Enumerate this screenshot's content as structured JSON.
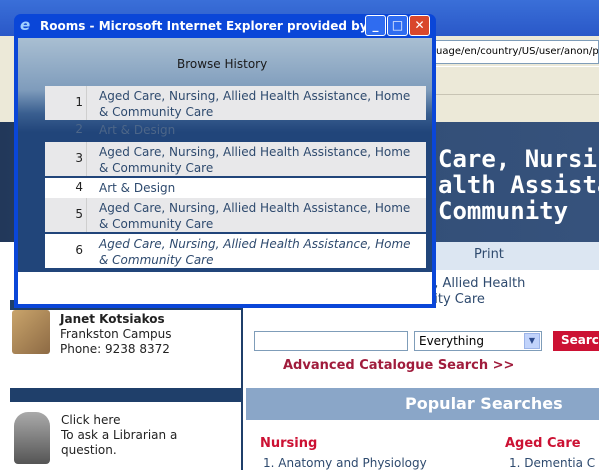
{
  "background": {
    "address_text": "uage/en/country/US/user/anon/pa",
    "banner_lines": [
      "Care, Nursi",
      "alth Assista",
      "Community"
    ],
    "print_label": "Print",
    "subheading_lines": [
      "g, Allied Health",
      "nity Care"
    ],
    "staff": {
      "name": "Janet Kotsiakos",
      "campus": "Frankston Campus",
      "phone": "Phone: 9238 8372"
    },
    "ask": {
      "link": "Click here",
      "line2": "To ask a Librarian a",
      "line3": "question."
    },
    "search": {
      "placeholder": "",
      "select_value": "Everything",
      "button_label": "Searc"
    },
    "advanced_link": "Advanced Catalogue Search >>",
    "popular_title": "Popular Searches",
    "categories": [
      {
        "title": "Nursing",
        "first_item": "1. Anatomy and Physiology"
      },
      {
        "title": "Aged Care",
        "first_item": "1. Dementia C"
      }
    ]
  },
  "popup": {
    "title": "Rooms - Microsoft Internet Explorer provided by ...",
    "icon": "ie-icon",
    "heading": "Browse History",
    "rows": [
      {
        "num": "1",
        "text": "Aged Care, Nursing, Allied Health Assistance, Home & Community Care"
      },
      {
        "num": "2",
        "text": "Art & Design"
      },
      {
        "num": "3",
        "text": "Aged Care, Nursing, Allied Health Assistance, Home & Community Care"
      },
      {
        "num": "4",
        "text": "Art & Design"
      },
      {
        "num": "5",
        "text": "Aged Care, Nursing, Allied Health Assistance, Home & Community Care"
      },
      {
        "num": "6",
        "text": "Aged Care, Nursing, Allied Health Assistance, Home & Community Care"
      }
    ]
  },
  "colors": {
    "xp_blue": "#0a46d8",
    "banner": "#304c74",
    "accent_red": "#cc1133"
  }
}
